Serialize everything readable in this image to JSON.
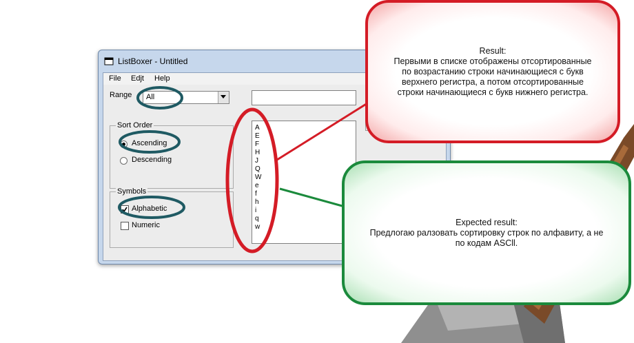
{
  "window": {
    "title": "ListBoxer - Untitled",
    "menu": [
      "File",
      "Edjt",
      "Help"
    ]
  },
  "form": {
    "range_label": "Range",
    "range_value": "All",
    "sort_order_label": "Sort Order",
    "ascending_label": "Ascending",
    "descending_label": "Descending",
    "sort_selected": "Ascending",
    "symbols_label": "Symbols",
    "alphabetic_label": "Alphabetic",
    "alphabetic_checked": true,
    "numeric_label": "Numeric",
    "numeric_checked": false
  },
  "listbox": {
    "items": [
      "A",
      "E",
      "F",
      "H",
      "J",
      "Q",
      "W",
      "e",
      "f",
      "h",
      "i",
      "q",
      "w"
    ]
  },
  "callouts": {
    "result_title": "Result:",
    "result_text": "Первыми в списке отображены отсортированные по возрастанию строки начинающиеся с букв верхнего регистра, а потом отсортированные строки начинающиеся с букв нижнего регистра.",
    "expected_title": "Expected result:",
    "expected_text": "Предлогаю ралзовать сортировку строк по алфавиту, а не по кодам ASCll."
  },
  "colors": {
    "red_accent": "#d41c26",
    "green_accent": "#1b8a3c",
    "teal_highlight": "#1f5a63"
  }
}
